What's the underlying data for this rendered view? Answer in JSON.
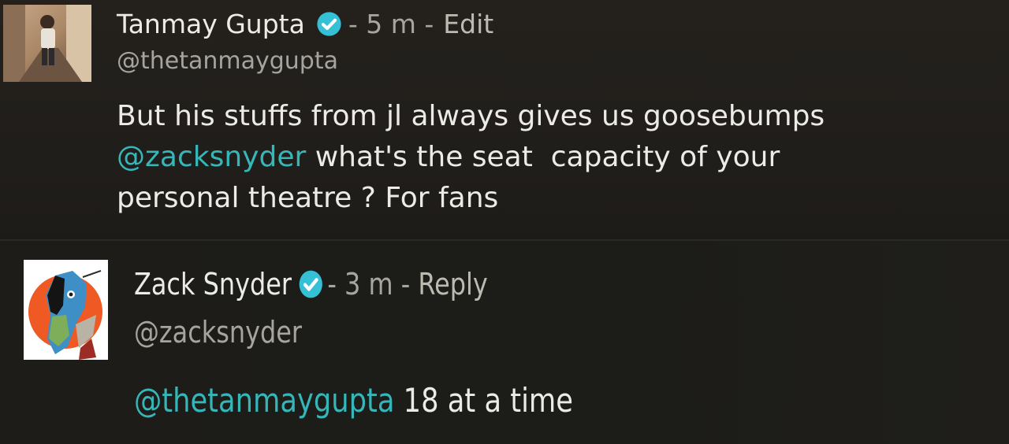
{
  "post": {
    "author_name": "Tanmay Gupta",
    "time": "- 5 m -",
    "action": "Edit",
    "handle": "@thetanmaygupta",
    "text_line1": "But his stuffs from jl always gives us goosebumps",
    "mention": "@zacksnyder",
    "text_line2_rest": " what's the seat  capacity of your",
    "text_line3": "personal theatre ? For fans"
  },
  "reply": {
    "author_name": "Zack Snyder",
    "time": "- 3 m -",
    "action": "Reply",
    "handle": "@zacksnyder",
    "mention": "@thetanmaygupta",
    "text_rest": " 18 at a time"
  },
  "icons": {
    "verified": "verified-check-icon"
  },
  "colors": {
    "mention": "#36b6b8",
    "verified_badge": "#35c0d6",
    "background": "#1c1b18"
  }
}
